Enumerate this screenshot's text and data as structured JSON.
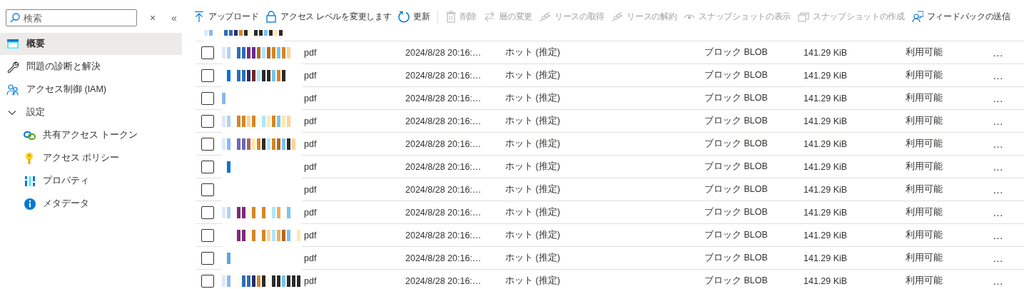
{
  "sidebar": {
    "search": {
      "placeholder": "検索"
    },
    "clear_label": "×",
    "collapse_label": "«",
    "items": [
      {
        "label": "概要",
        "selected": true
      },
      {
        "label": "問題の診断と解決",
        "selected": false
      },
      {
        "label": "アクセス制御 (IAM)",
        "selected": false
      },
      {
        "label": "設定",
        "selected": false,
        "expanded": true,
        "children": [
          {
            "label": "共有アクセス トークン",
            "selected": false
          },
          {
            "label": "アクセス ポリシー",
            "selected": false
          },
          {
            "label": "プロパティ",
            "selected": false
          },
          {
            "label": "メタデータ",
            "selected": false
          }
        ]
      }
    ]
  },
  "toolbar": [
    {
      "label": "アップロード",
      "disabled": false
    },
    {
      "label": "アクセス レベルを変更します",
      "disabled": false
    },
    {
      "label": "更新",
      "disabled": false
    },
    {
      "label": "削除",
      "disabled": true
    },
    {
      "label": "層の変更",
      "disabled": true
    },
    {
      "label": "リースの取得",
      "disabled": true
    },
    {
      "label": "リースの解約",
      "disabled": true
    },
    {
      "label": "スナップショットの表示",
      "disabled": true
    },
    {
      "label": "スナップショットの作成",
      "disabled": true
    },
    {
      "label": "フィードバックの送信",
      "disabled": false
    }
  ],
  "table": {
    "rows": [
      {
        "checked": false,
        "name": "pdf",
        "date": "2024/8/28 20:16:…",
        "tier": "ホット (推定)",
        "blob_type": "ブロック BLOB",
        "size": "141.29 KiB",
        "status": "利用可能",
        "menu": "…"
      },
      {
        "checked": false,
        "name": "pdf",
        "date": "2024/8/28 20:16:…",
        "tier": "ホット (推定)",
        "blob_type": "ブロック BLOB",
        "size": "141.29 KiB",
        "status": "利用可能",
        "menu": "…"
      },
      {
        "checked": false,
        "name": "pdf",
        "date": "2024/8/28 20:16:…",
        "tier": "ホット (推定)",
        "blob_type": "ブロック BLOB",
        "size": "141.29 KiB",
        "status": "利用可能",
        "menu": "…"
      },
      {
        "checked": false,
        "name": "pdf",
        "date": "2024/8/28 20:16:…",
        "tier": "ホット (推定)",
        "blob_type": "ブロック BLOB",
        "size": "141.29 KiB",
        "status": "利用可能",
        "menu": "…"
      },
      {
        "checked": false,
        "name": "pdf",
        "date": "2024/8/28 20:16:…",
        "tier": "ホット (推定)",
        "blob_type": "ブロック BLOB",
        "size": "141.29 KiB",
        "status": "利用可能",
        "menu": "…"
      },
      {
        "checked": false,
        "name": "pdf",
        "date": "2024/8/28 20:16:…",
        "tier": "ホット (推定)",
        "blob_type": "ブロック BLOB",
        "size": "141.29 KiB",
        "status": "利用可能",
        "menu": "…"
      },
      {
        "checked": false,
        "name": "pdf",
        "date": "2024/8/28 20:16:…",
        "tier": "ホット (推定)",
        "blob_type": "ブロック BLOB",
        "size": "141.29 KiB",
        "status": "利用可能",
        "menu": "…"
      },
      {
        "checked": false,
        "name": "pdf",
        "date": "2024/8/28 20:16:…",
        "tier": "ホット (推定)",
        "blob_type": "ブロック BLOB",
        "size": "141.29 KiB",
        "status": "利用可能",
        "menu": "…"
      },
      {
        "checked": false,
        "name": "pdf",
        "date": "2024/8/28 20:16:…",
        "tier": "ホット (推定)",
        "blob_type": "ブロック BLOB",
        "size": "141.29 KiB",
        "status": "利用可能",
        "menu": "…"
      },
      {
        "checked": false,
        "name": "pdf",
        "date": "2024/8/28 20:16:…",
        "tier": "ホット (推定)",
        "blob_type": "ブロック BLOB",
        "size": "141.29 KiB",
        "status": "利用可能",
        "menu": "…"
      },
      {
        "checked": false,
        "name": "pdf",
        "date": "2024/8/28 20:16:…",
        "tier": "ホット (推定)",
        "blob_type": "ブロック BLOB",
        "size": "141.29 KiB",
        "status": "利用可能",
        "menu": "…"
      }
    ]
  }
}
